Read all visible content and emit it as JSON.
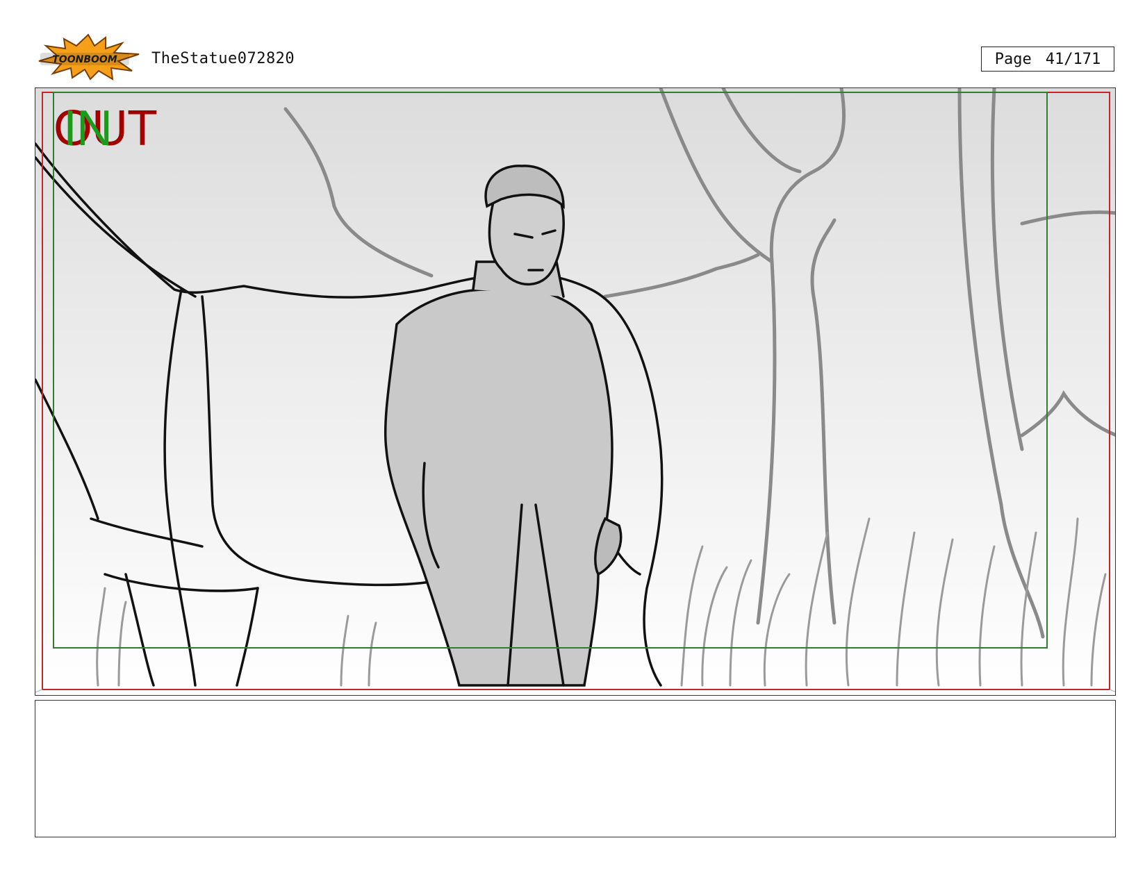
{
  "header": {
    "logo_text": "TOONBOOM",
    "title": "TheStatue072820",
    "page_label": "Page",
    "page_number": "41/171"
  },
  "panel": {
    "out_marker": "OUT",
    "in_marker": "IN",
    "safe_frame_color": "#c0262c",
    "title_safe_color": "#2e7d32"
  },
  "notes": {
    "text": ""
  }
}
